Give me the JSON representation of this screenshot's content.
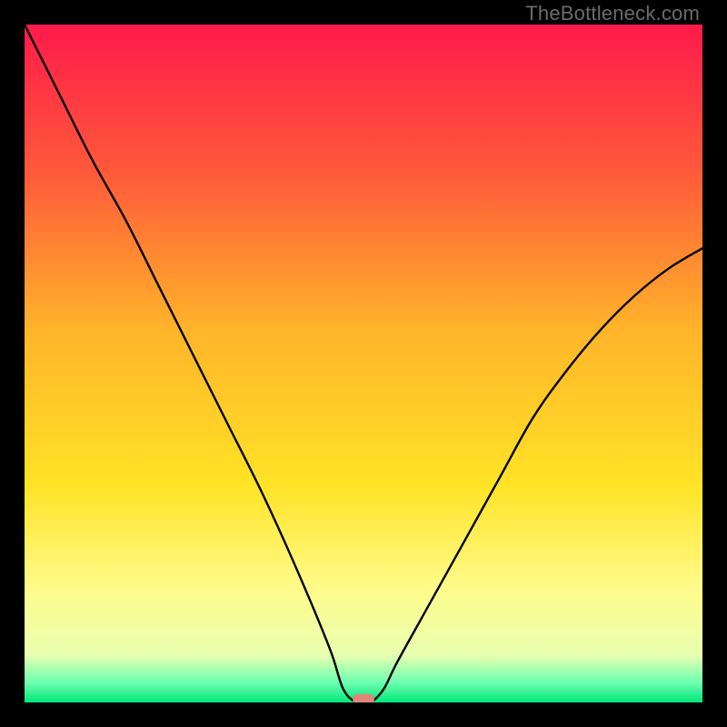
{
  "watermark": "TheBottleneck.com",
  "chart_data": {
    "type": "line",
    "title": "",
    "xlabel": "",
    "ylabel": "",
    "xlim": [
      0,
      100
    ],
    "ylim": [
      0,
      100
    ],
    "grid": false,
    "legend": false,
    "gradient_stops": [
      {
        "offset": 0,
        "color": "#ff1a4b"
      },
      {
        "offset": 0.22,
        "color": "#ff5a3a"
      },
      {
        "offset": 0.45,
        "color": "#ffb42a"
      },
      {
        "offset": 0.68,
        "color": "#ffe326"
      },
      {
        "offset": 0.83,
        "color": "#fffb8a"
      },
      {
        "offset": 0.93,
        "color": "#e9ffb0"
      },
      {
        "offset": 0.97,
        "color": "#6fffb0"
      },
      {
        "offset": 1.0,
        "color": "#00e77a"
      }
    ],
    "series": [
      {
        "name": "bottleneck-curve",
        "x": [
          0,
          5,
          10,
          15,
          20,
          25,
          30,
          35,
          40,
          45,
          47,
          49,
          51,
          53,
          55,
          60,
          65,
          70,
          75,
          80,
          85,
          90,
          95,
          100
        ],
        "values": [
          100,
          90,
          80,
          71,
          61,
          51,
          41,
          31,
          20,
          8,
          2,
          0,
          0,
          2,
          6,
          15,
          24,
          33,
          42,
          49,
          55,
          60,
          64,
          67
        ]
      }
    ],
    "marker": {
      "x": 50,
      "y": 0.5,
      "width": 3.2,
      "height": 1.5,
      "color": "#e0857a",
      "radius": 0.7
    }
  }
}
